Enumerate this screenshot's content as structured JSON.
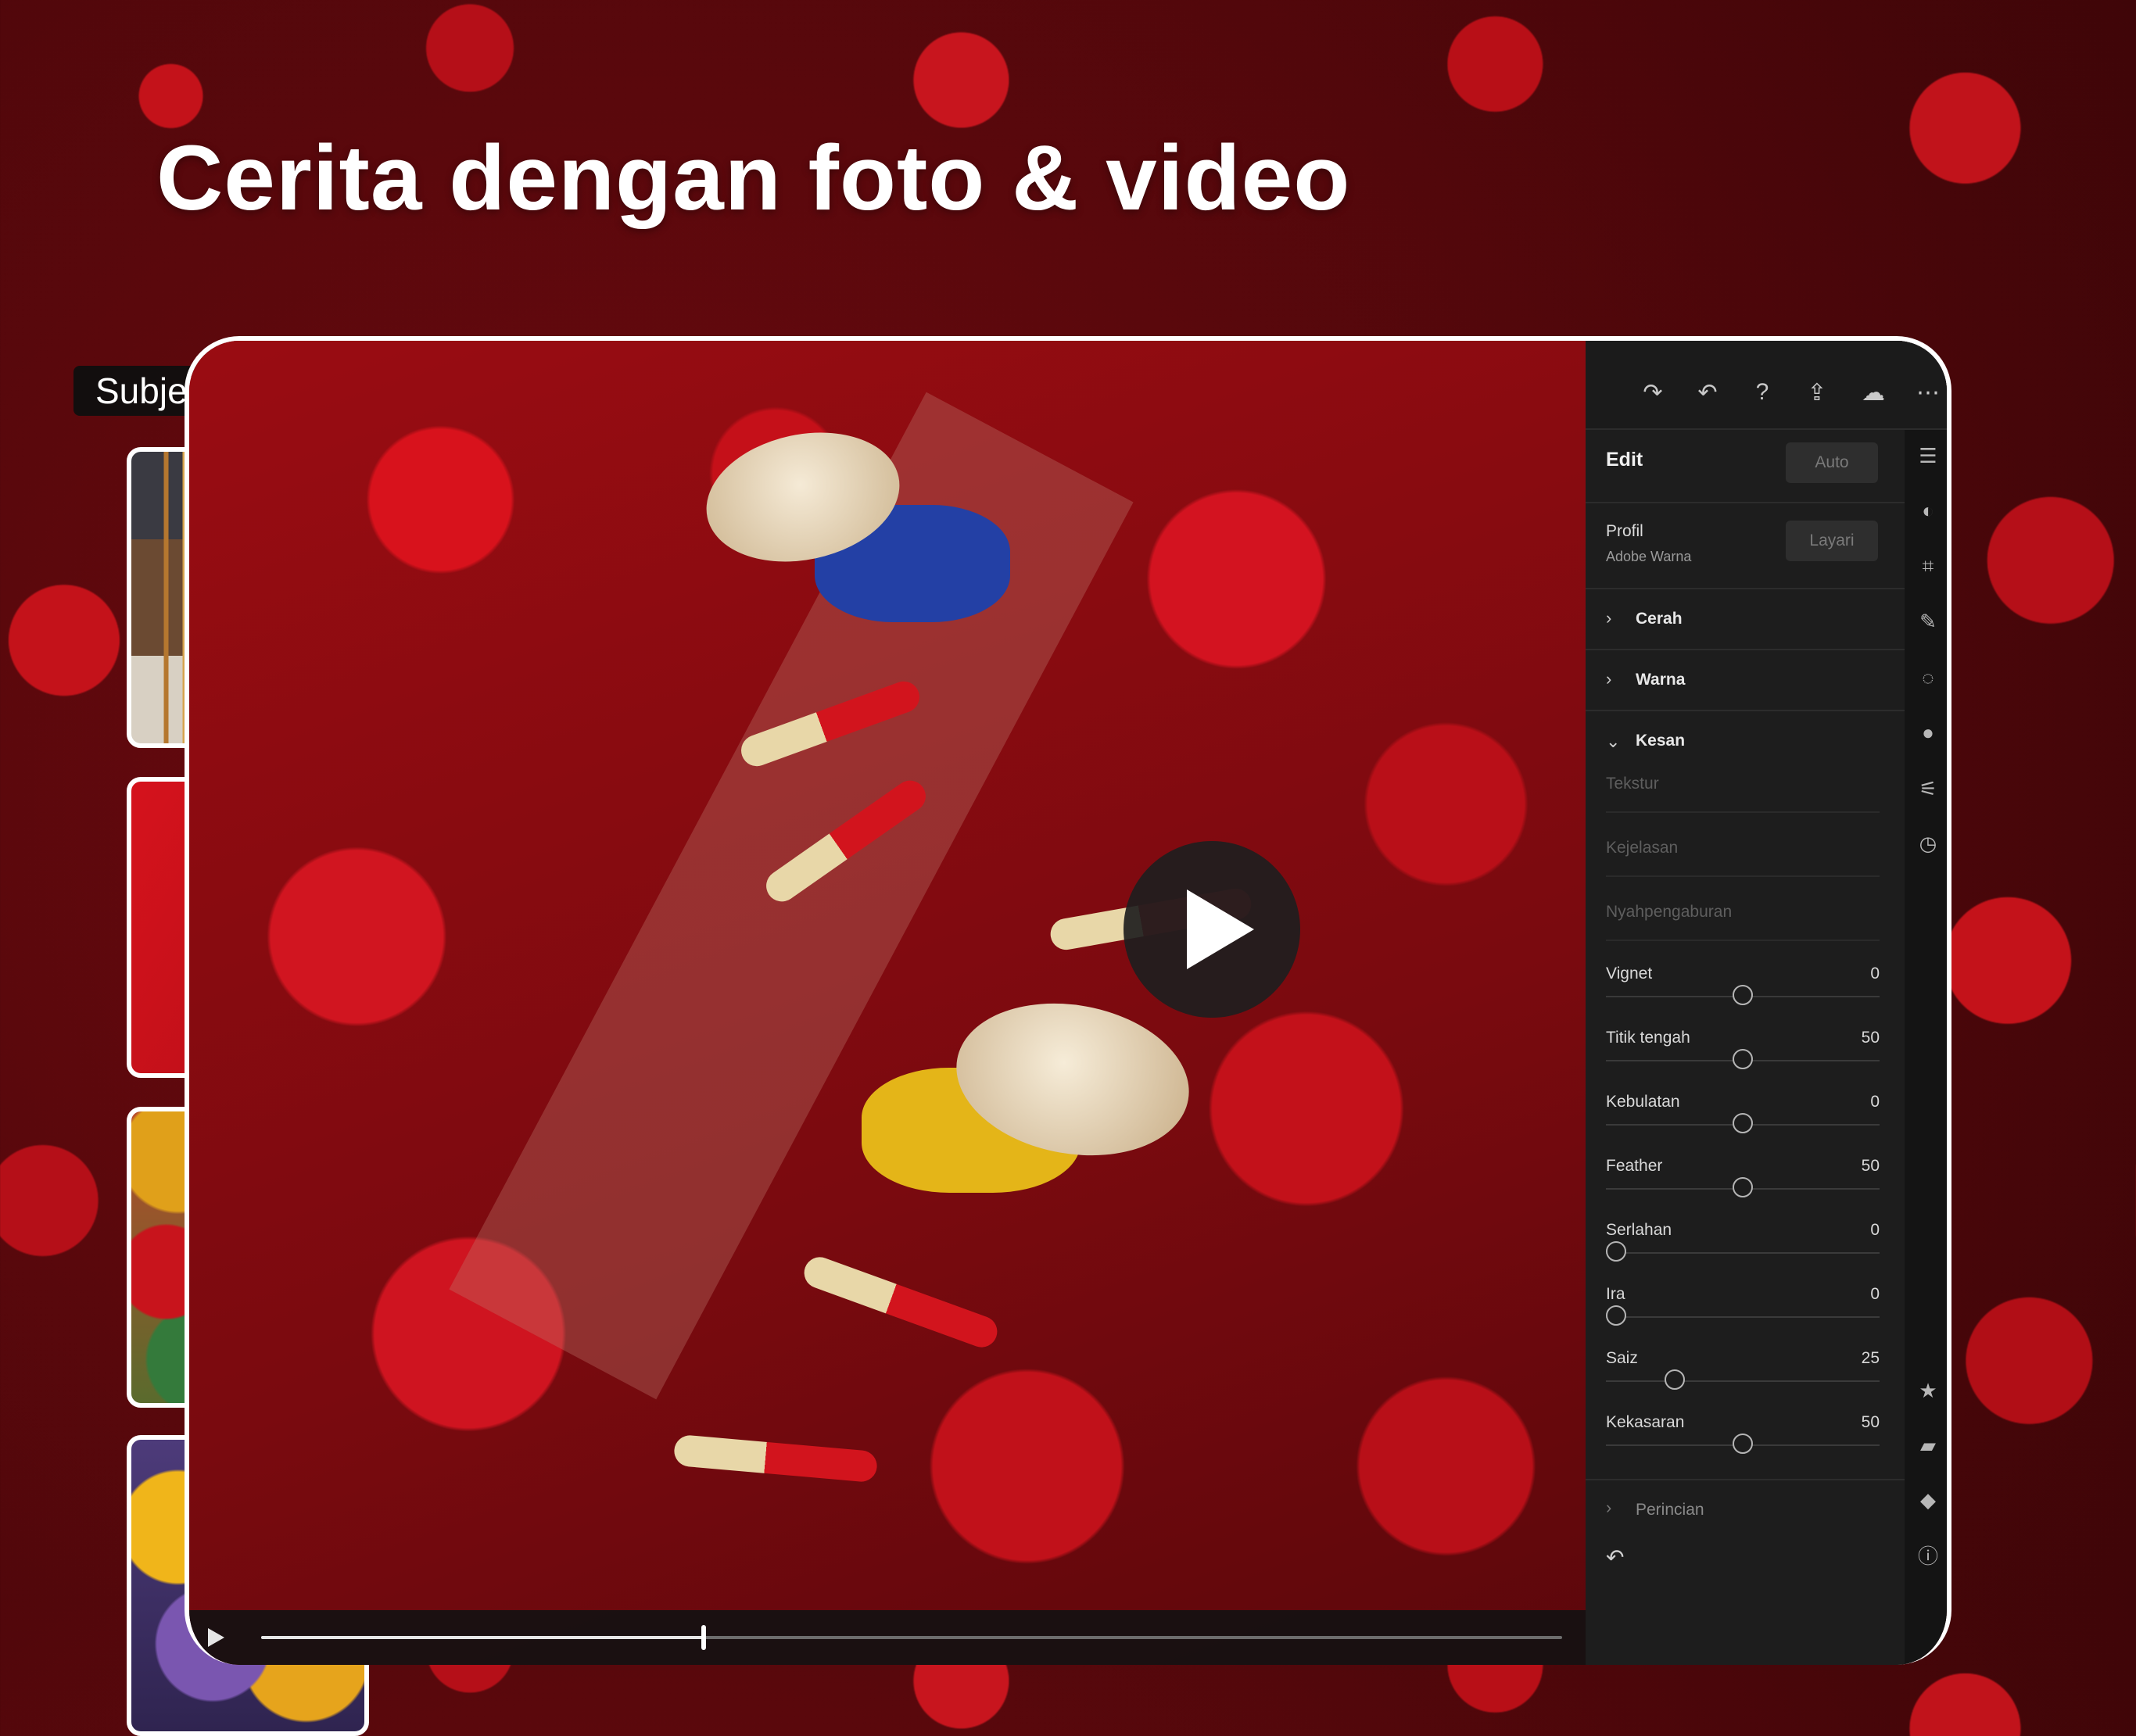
{
  "headline": "Cerita dengan foto & video",
  "subject_tag": "Subjek: Melancong",
  "thumbnails": [
    {
      "name": "incense-temple-thumbnail"
    },
    {
      "name": "red-incense-path-thumbnail"
    },
    {
      "name": "colorful-incense-video-thumbnail",
      "has_play": true
    },
    {
      "name": "yellow-purple-incense-thumbnail"
    }
  ],
  "video": {
    "progress": 0.34
  },
  "panel": {
    "edit_title": "Edit",
    "auto_button": "Auto",
    "profile_label": "Profil",
    "profile_value": "Adobe Warna",
    "browse_button": "Layari",
    "sections": {
      "light": "Cerah",
      "color": "Warna",
      "effects": "Kesan",
      "detail": "Perincian"
    },
    "disabled_sliders": [
      "Tekstur",
      "Kejelasan",
      "Nyahpengaburan"
    ],
    "sliders": [
      {
        "name": "Vignet",
        "value": "0",
        "pos": 0.5
      },
      {
        "name": "Titik tengah",
        "value": "50",
        "pos": 0.5
      },
      {
        "name": "Kebulatan",
        "value": "0",
        "pos": 0.5
      },
      {
        "name": "Feather",
        "value": "50",
        "pos": 0.5
      },
      {
        "name": "Serlahan",
        "value": "0",
        "pos": 0.0
      },
      {
        "name": "Ira",
        "value": "0",
        "pos": 0.0
      },
      {
        "name": "Saiz",
        "value": "25",
        "pos": 0.25
      },
      {
        "name": "Kekasaran",
        "value": "50",
        "pos": 0.5
      }
    ]
  },
  "toolbar_icons": [
    "redo-icon",
    "undo-icon",
    "help-icon",
    "share-icon",
    "cloud-synced-icon",
    "more-icon"
  ],
  "rail_icons": [
    "edit-sliders-icon",
    "presets-icon",
    "crop-icon",
    "healing-brush-icon",
    "masking-icon",
    "color-drop-icon",
    "versions-icon",
    "history-icon",
    "rating-star-icon",
    "comment-icon",
    "keyword-tag-icon",
    "info-icon"
  ]
}
